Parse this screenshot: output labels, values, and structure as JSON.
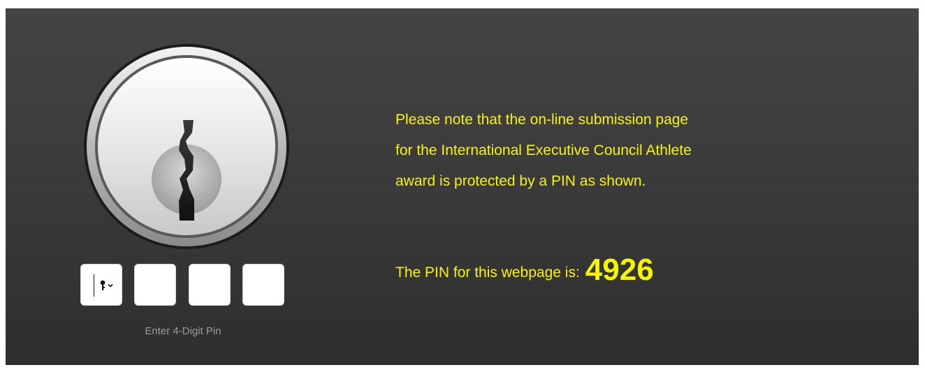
{
  "note": {
    "lines": [
      "Please note that the on-line submission page",
      "for the International Executive Council Athlete",
      "award is protected by a PIN as shown."
    ]
  },
  "pin_notice": {
    "label": "The PIN for this webpage is:",
    "value": "4926"
  },
  "pin_entry": {
    "hint": "Enter 4-Digit Pin",
    "digits": [
      "",
      "",
      "",
      ""
    ],
    "key_menu_icon": "key-icon"
  },
  "lock_icon": "keyhole-lock-icon",
  "colors": {
    "accent_text": "#f6f600",
    "panel_background": "#3b3b3b",
    "hint_text": "#9a9a9a"
  }
}
